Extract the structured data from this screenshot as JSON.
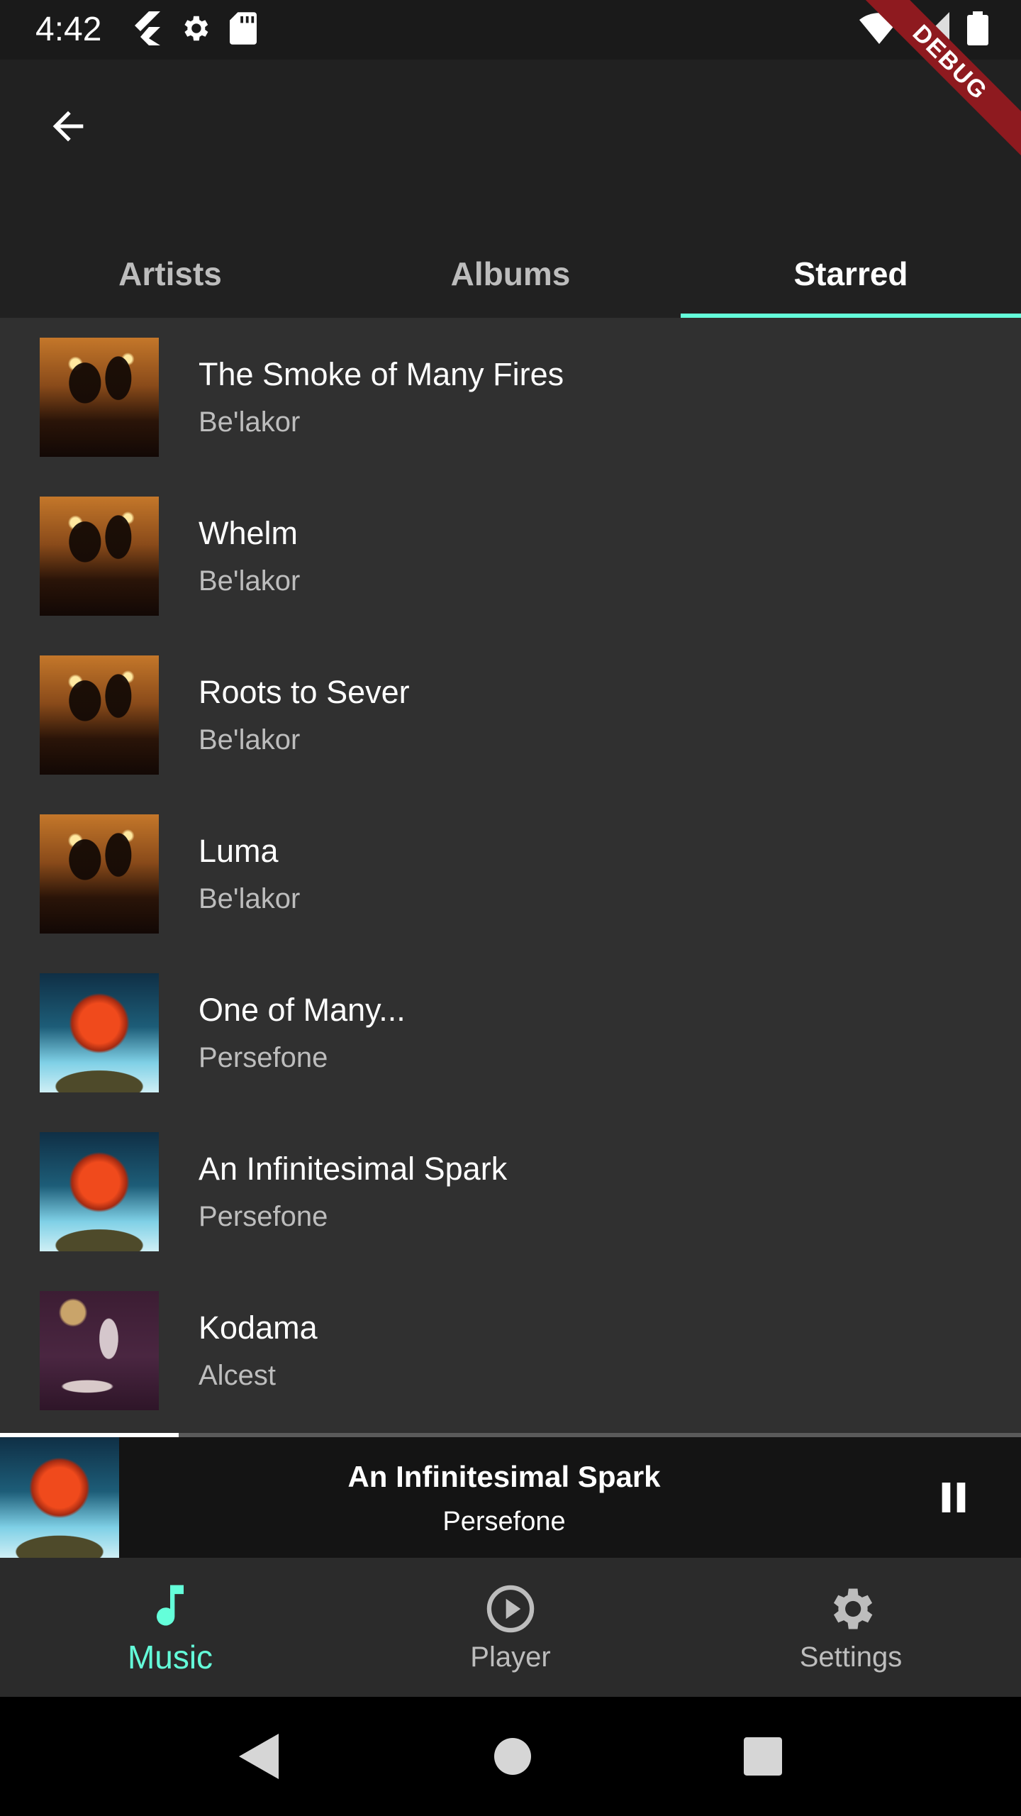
{
  "status_bar": {
    "time": "4:42",
    "left_icons": [
      "flutter-icon",
      "gear-icon",
      "sd-card-icon"
    ],
    "right_icons": [
      "wifi-icon",
      "signal-icon",
      "battery-icon"
    ]
  },
  "debug_banner": "DEBUG",
  "app_bar": {
    "back_icon": "arrow-back-icon",
    "tabs": [
      {
        "label": "Artists",
        "active": false
      },
      {
        "label": "Albums",
        "active": false
      },
      {
        "label": "Starred",
        "active": true
      }
    ]
  },
  "starred": [
    {
      "title": "The Smoke of Many Fires",
      "artist": "Be'lakor",
      "art": "belakor"
    },
    {
      "title": "Whelm",
      "artist": "Be'lakor",
      "art": "belakor"
    },
    {
      "title": "Roots to Sever",
      "artist": "Be'lakor",
      "art": "belakor"
    },
    {
      "title": "Luma",
      "artist": "Be'lakor",
      "art": "belakor"
    },
    {
      "title": "One of Many...",
      "artist": "Persefone",
      "art": "persefone"
    },
    {
      "title": "An Infinitesimal Spark",
      "artist": "Persefone",
      "art": "persefone"
    },
    {
      "title": "Kodama",
      "artist": "Alcest",
      "art": "alcest"
    }
  ],
  "now_playing": {
    "title": "An Infinitesimal Spark",
    "artist": "Persefone",
    "progress": 0.175,
    "control_icon": "pause-icon"
  },
  "bottom_nav": [
    {
      "label": "Music",
      "icon": "music-note-icon",
      "active": true
    },
    {
      "label": "Player",
      "icon": "play-circle-icon",
      "active": false
    },
    {
      "label": "Settings",
      "icon": "gear-icon",
      "active": false
    }
  ],
  "system_nav": [
    "back-triangle-icon",
    "home-circle-icon",
    "recents-square-icon"
  ],
  "colors": {
    "accent": "#64ffda",
    "background": "#303030",
    "app_bar": "#212121",
    "now_playing_bg": "#141414"
  }
}
